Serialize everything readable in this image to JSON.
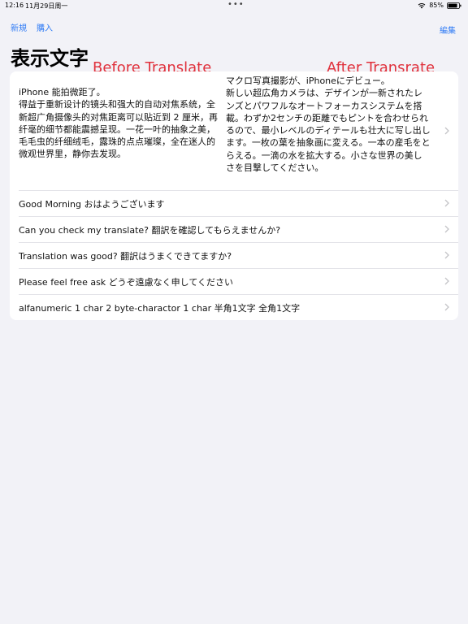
{
  "status_bar": {
    "time": "12:16",
    "date": "11月29日周一",
    "dots": "•••",
    "battery": "85%"
  },
  "nav": {
    "new_label": "新規",
    "buy_label": "購入",
    "edit_label": "編集"
  },
  "page_title": "表示文字",
  "annotations": {
    "before": "Before Translate",
    "after": "After Transrate"
  },
  "first_row": {
    "source": "iPhone 能拍微距了。\n得益于重新设计的镜头和强大的自动对焦系统，全新超广角摄像头的对焦距离可以贴近到 2 厘米，再纤毫的细节都能震撼呈现。一花一叶的抽象之美，毛毛虫的纤细绒毛，露珠的点点璀璨，全在迷人的微观世界里，静你去发现。",
    "translation": "マクロ写真撮影が、iPhoneにデビュー。\n新しい超広角カメラは、デザインが一新されたレンズとパワフルなオートフォーカスシステムを搭載。わずか2センチの距離でもピントを合わせられるので、最小レベルのディテールも壮大に写し出します。一枚の葉を抽象画に変える。一本の産毛をとらえる。一滴の水を拡大する。小さな世界の美しさを目撃してください。"
  },
  "rows": [
    {
      "text": "Good Morning  おはようございます"
    },
    {
      "text": "Can you check my translate?  翻訳を確認してもらえませんか?"
    },
    {
      "text": "Translation was good?  翻訳はうまくできてますか?"
    },
    {
      "text": "Please feel free ask  どうぞ遠慮なく申してください"
    },
    {
      "text": "alfanumeric 1 char 2 byte-charactor 1 char  半角1文字 全角1文字"
    }
  ],
  "colors": {
    "accent": "#2f7bf5",
    "annotation": "#e0313c",
    "background": "#f2f2f7",
    "card": "#ffffff",
    "chevron": "#c4c4c7"
  },
  "icons": {
    "wifi": "wifi-icon",
    "battery": "battery-icon",
    "chevron": "chevron-right-icon"
  }
}
